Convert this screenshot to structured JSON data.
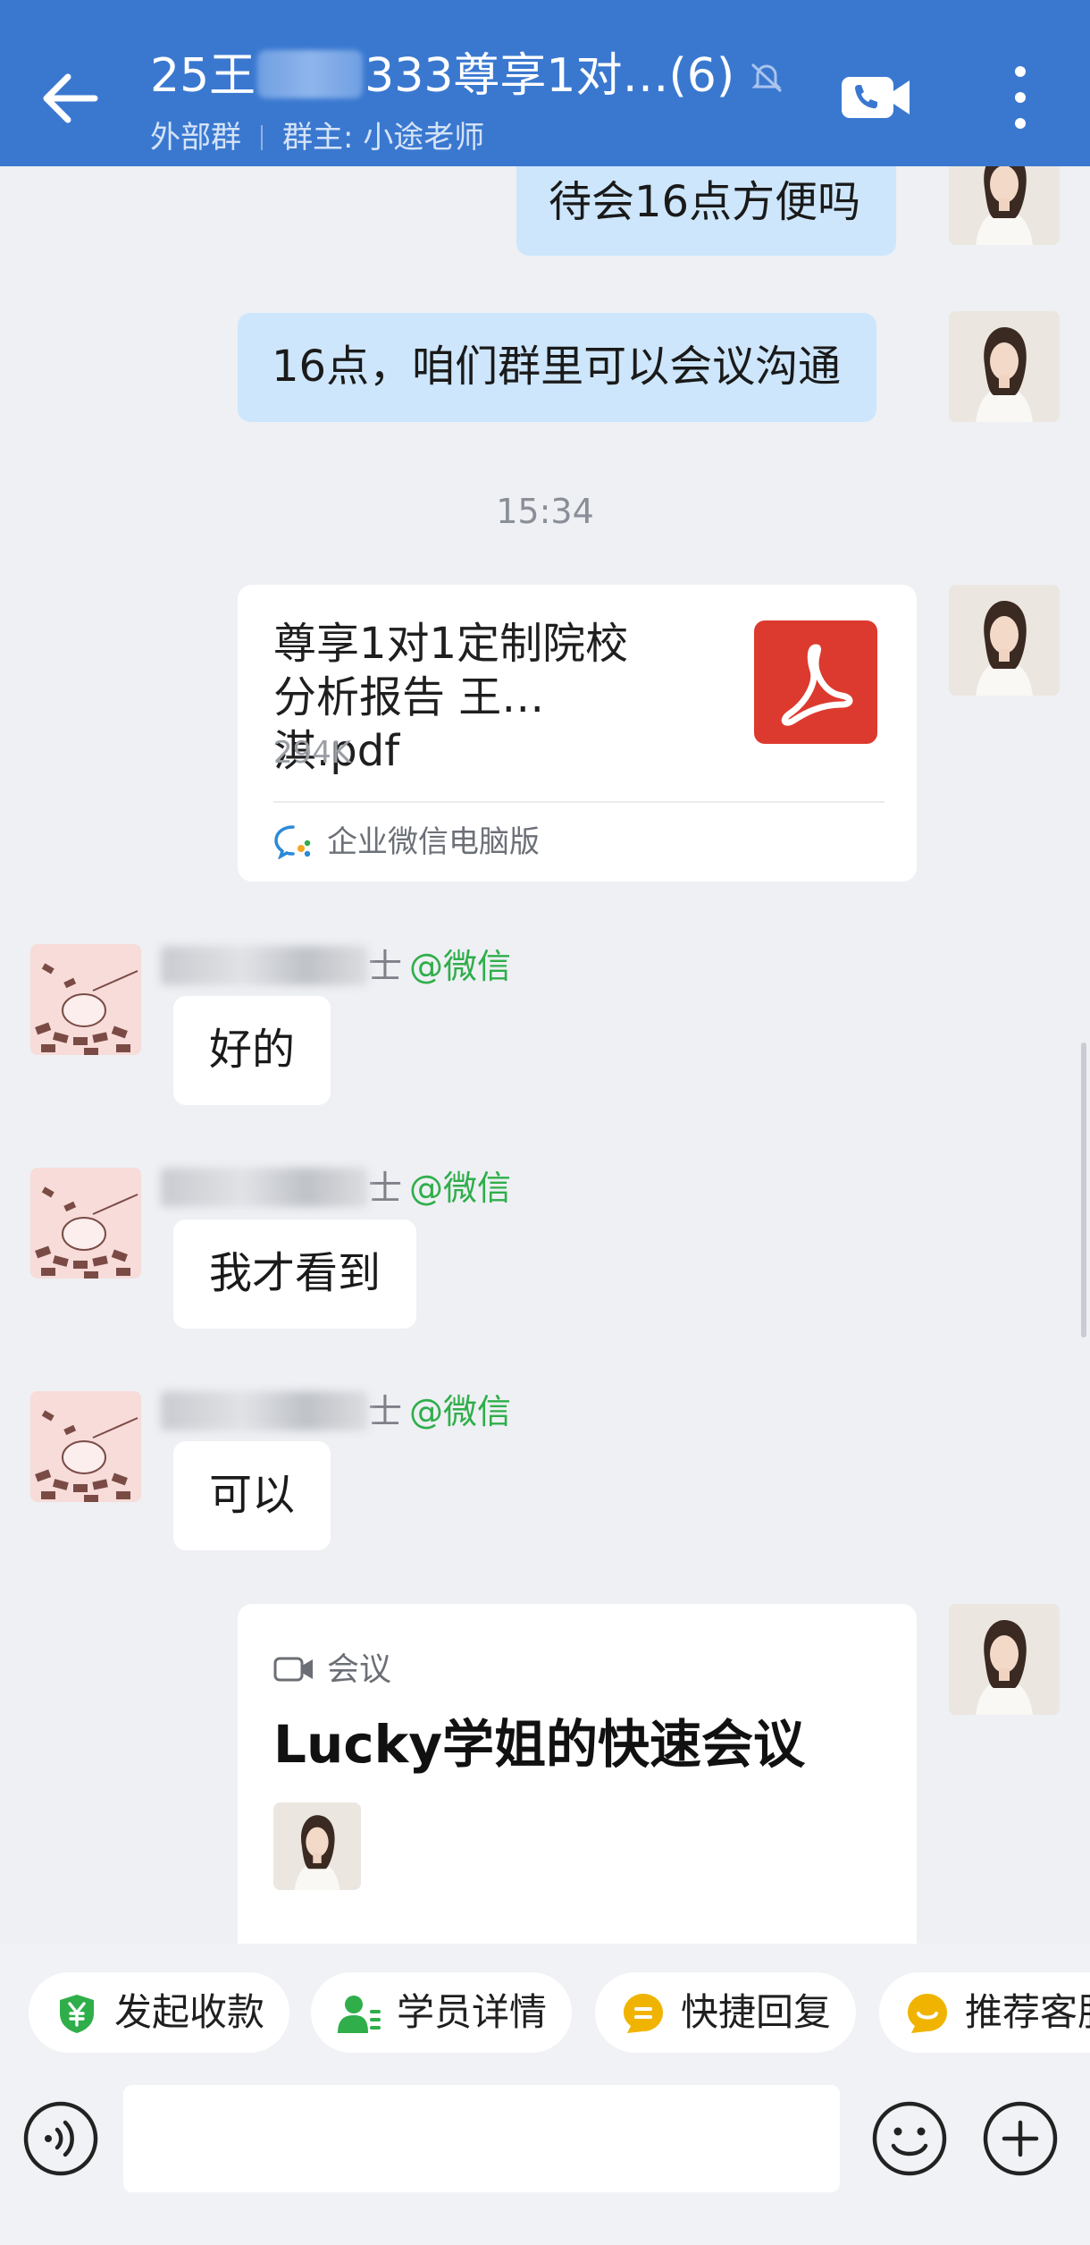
{
  "header": {
    "title_prefix": "25王",
    "title_suffix": "333尊享1对…(6)",
    "group_type": "外部群",
    "group_owner": "群主: 小途老师"
  },
  "messages": {
    "out1": "待会16点方便吗",
    "out2": "16点，咱们群里可以会议沟通",
    "time1": "15:34",
    "file": {
      "name_line1": "尊享1对1定制院校",
      "name_line2": "分析报告 王…淇.pdf",
      "size": "294K",
      "source": "企业微信电脑版"
    },
    "sender_suffix": "士",
    "sender_tag": "@微信",
    "in1": "好的",
    "in2": "我才看到",
    "in3": "可以",
    "meeting": {
      "type_label": "会议",
      "title": "Lucky学姐的快速会议"
    }
  },
  "quick_actions": [
    {
      "label": "发起收款",
      "icon": "yuan-shield-icon",
      "color": "#2fae4a"
    },
    {
      "label": "学员详情",
      "icon": "student-icon",
      "color": "#2fae4a"
    },
    {
      "label": "快捷回复",
      "icon": "quick-reply-icon",
      "color": "#f0b400"
    },
    {
      "label": "推荐客服",
      "icon": "recommend-icon",
      "color": "#f0b400"
    }
  ],
  "input": {
    "value": "",
    "placeholder": ""
  },
  "colors": {
    "header_bg": "#3a78d0",
    "out_bubble": "#cde6fb",
    "in_bubble": "#ffffff",
    "chat_bg": "#eef0f4",
    "wechat_tag": "#2fae4a",
    "pdf_red": "#dd3a2f"
  }
}
